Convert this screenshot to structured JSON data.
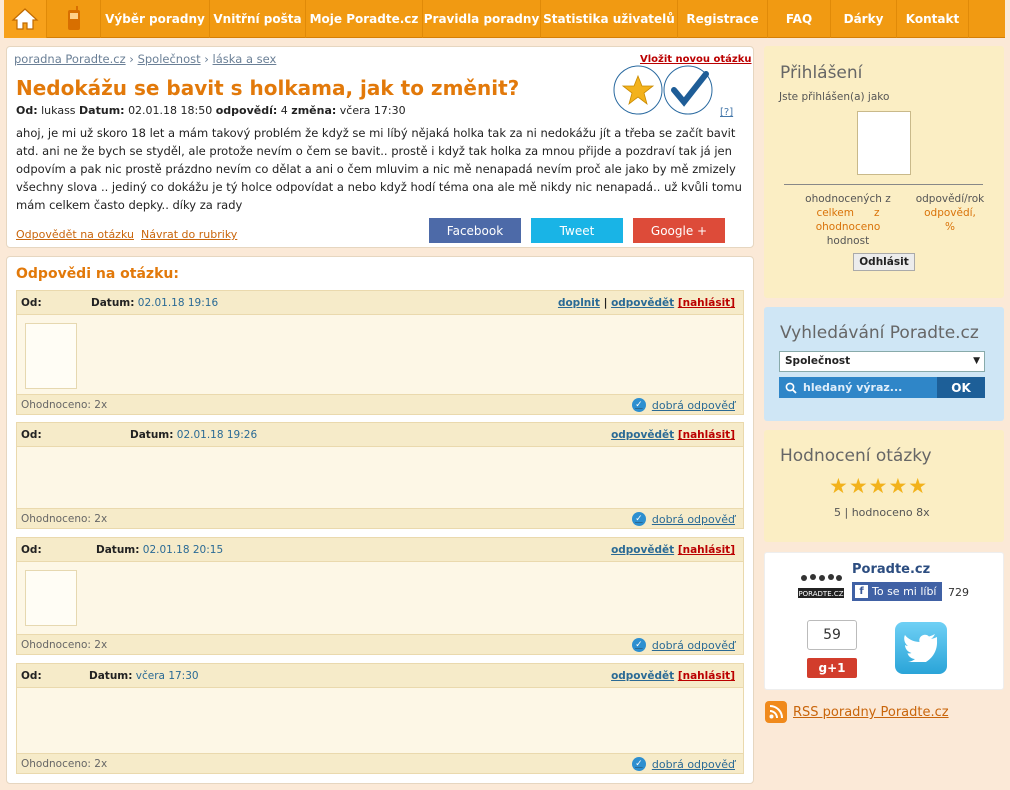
{
  "nav": {
    "items": [
      "Výběr poradny",
      "Vnitřní pošta",
      "Moje Poradte.cz",
      "Pravidla poradny",
      "Statistika uživatelů",
      "Registrace",
      "FAQ",
      "Dárky",
      "Kontakt"
    ]
  },
  "breadcrumb": [
    "poradna Poradte.cz",
    "Společnost",
    "láska a sex"
  ],
  "question": {
    "new_question": "Vložit novou otázku",
    "title": "Nedokážu se bavit s holkama, jak to změnit?",
    "meta_od_label": "Od:",
    "meta_od_value": "lukass",
    "meta_date_label": "Datum:",
    "meta_date_value": "02.01.18 18:50",
    "meta_answers_label": "odpovědí:",
    "meta_answers_value": "4",
    "meta_change_label": "změna:",
    "meta_change_value": "včera 17:30",
    "help": "[?]",
    "text": "ahoj, je mi už skoro 18 let a mám takový problém že když se mi líbý nějaká holka tak za ni nedokážu jít a třeba se začít bavit atd. ani ne že bych se styděl, ale protože nevím o čem se bavit.. prostě i když tak holka za mnou přijde a pozdraví tak já jen odpovím a pak nic prostě prázdno nevím co dělat a ani o čem mluvim a nic mě nenapadá nevím proč ale jako by mě zmizely všechny slova .. jediný co dokážu je tý holce odpovídat a nebo když hodí téma ona ale mě nikdy nic nenapadá.. už kvůli tomu mám celkem často depky.. díky za rady",
    "answer_link": "Odpovědět na otázku",
    "back_link": "Návrat do rubriky",
    "share": [
      "Facebook",
      "Tweet",
      "Google +"
    ],
    "badge_text": "Přidat k oblíbeným · Zajímavé"
  },
  "answers": {
    "heading": "Odpovědi na otázku:",
    "od_label": "Od:",
    "date_label": "Datum:",
    "complete": "doplnit",
    "sep": "|",
    "reply": "odpovědět",
    "report": "[nahlásit]",
    "rating": "Ohodnoceno: 2x",
    "good": "dobrá odpověď",
    "items": [
      {
        "date": "02.01.18 19:16"
      },
      {
        "date": "02.01.18 19:26"
      },
      {
        "date": "02.01.18 20:15"
      },
      {
        "date": "včera 17:30"
      }
    ]
  },
  "login": {
    "title": "Přihlášení",
    "logged_as": "Jste přihlášen(a) jako",
    "stat1_a": "ohodnocených z",
    "stat1_b": "celkem",
    "stat1_c": "z",
    "stat1_d": "ohodnoceno",
    "stat1_e": "hodnost",
    "stat2_a": "odpovědí/rok",
    "stat2_b": "odpovědí,",
    "stat2_c": "%",
    "logout": "Odhlásit"
  },
  "search": {
    "title": "Vyhledávání Poradte.cz",
    "category": "Společnost",
    "placeholder": "hledaný výraz...",
    "ok": "OK"
  },
  "rating_box": {
    "title": "Hodnocení otázky",
    "stars": "★★★★★",
    "text": "5 | hodnoceno 8x"
  },
  "social": {
    "page_name": "Poradte.cz",
    "like": "To se mi líbí",
    "like_count": "729",
    "gplus_count": "59",
    "gplus": "+1",
    "logo_text": "PORADTE.CZ"
  },
  "rss": "RSS poradny Poradte.cz",
  "colors": {
    "nav": "#f19a12",
    "accent_orange": "#e2790a",
    "link_blue": "#2a6a95",
    "facebook": "#4d6aa8",
    "twitter": "#19b4e6",
    "google": "#dd4b39"
  }
}
